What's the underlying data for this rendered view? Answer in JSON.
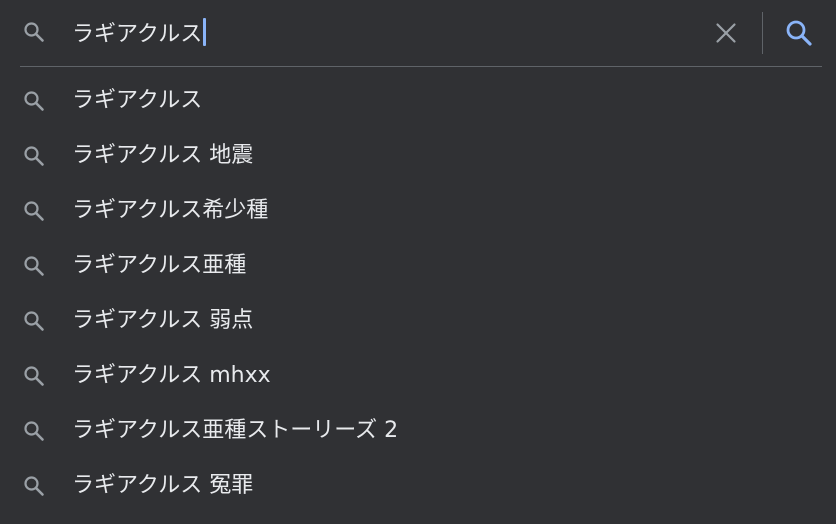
{
  "search": {
    "query": "ラギアクルス",
    "icon": "search-icon",
    "clear_icon": "close-icon",
    "submit_icon": "search-icon",
    "colors": {
      "background": "#303134",
      "text": "#e8eaed",
      "icon_gray": "#9aa0a6",
      "accent": "#8ab4f8",
      "divider": "#5f6368"
    }
  },
  "suggestions": [
    {
      "label": "ラギアクルス"
    },
    {
      "label": "ラギアクルス 地震"
    },
    {
      "label": "ラギアクルス希少種"
    },
    {
      "label": "ラギアクルス亜種"
    },
    {
      "label": "ラギアクルス 弱点"
    },
    {
      "label": "ラギアクルス mhxx"
    },
    {
      "label": "ラギアクルス亜種ストーリーズ 2"
    },
    {
      "label": "ラギアクルス 冤罪"
    }
  ]
}
